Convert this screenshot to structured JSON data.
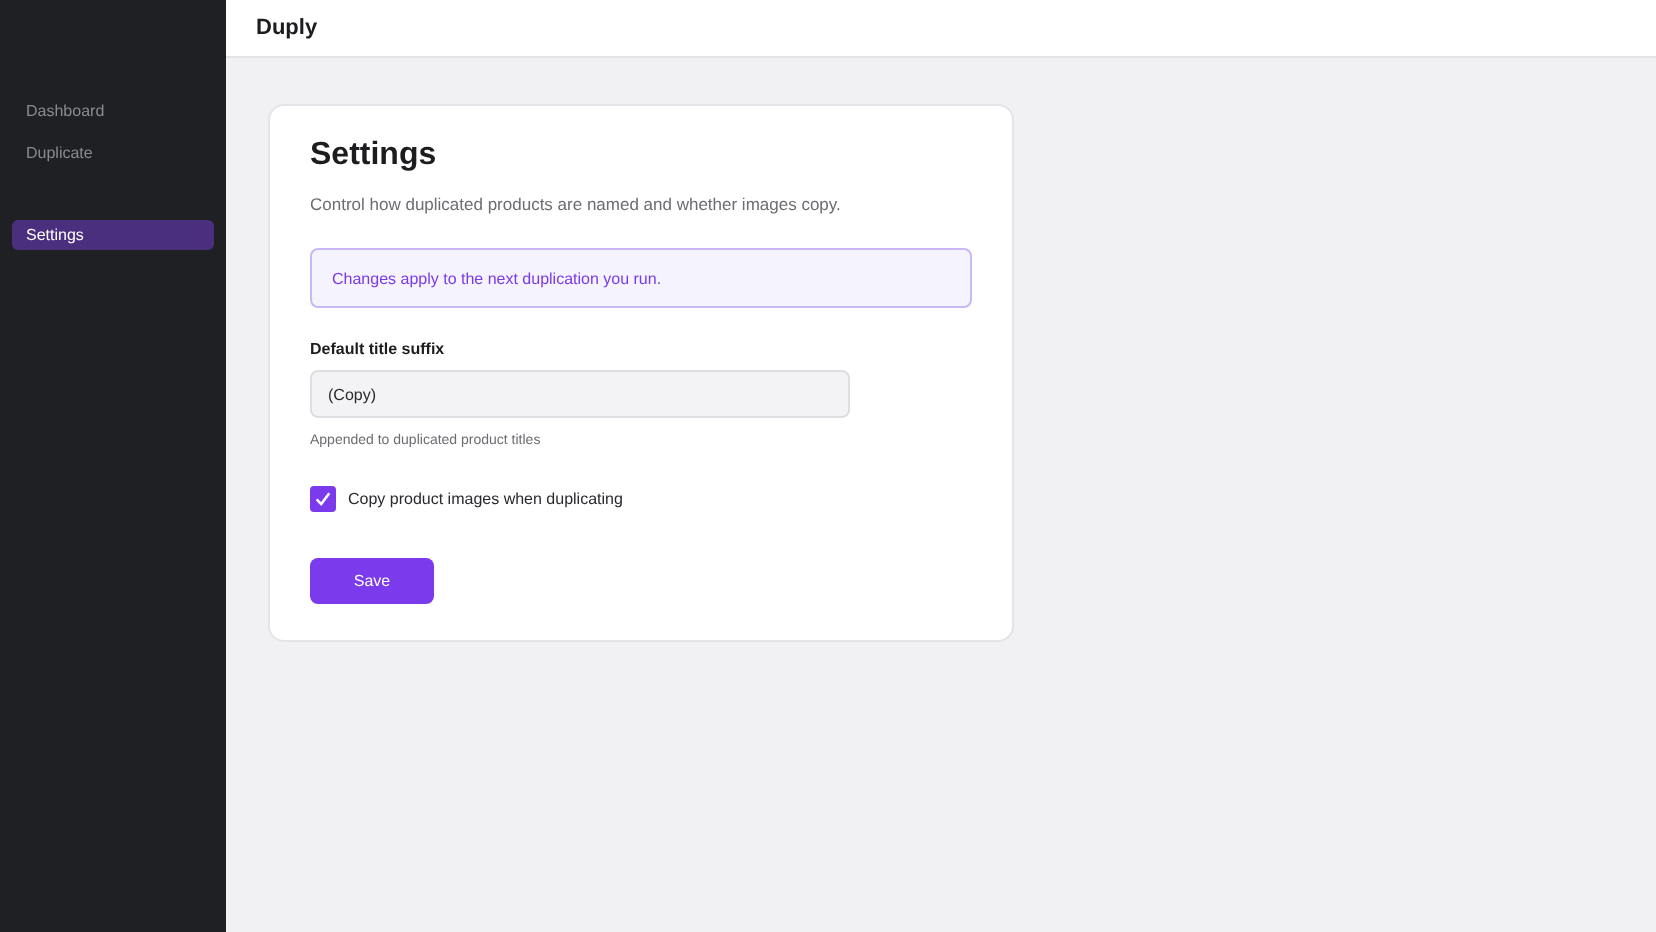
{
  "sidebar": {
    "items": [
      {
        "label": "Dashboard",
        "selected": false
      },
      {
        "label": "Duplicate",
        "selected": false
      },
      {
        "label": "Settings",
        "selected": true
      }
    ]
  },
  "header": {
    "title": "Duply"
  },
  "settings": {
    "title": "Settings",
    "description": "Control how duplicated products are named and whether images copy.",
    "notice": "Changes apply to the next duplication you run.",
    "suffix_label": "Default title suffix",
    "suffix_value": "(Copy)",
    "suffix_help": "Appended to duplicated product titles",
    "copy_images": {
      "label": "Copy product images when duplicating",
      "checked": true
    },
    "save_button": "Save"
  }
}
